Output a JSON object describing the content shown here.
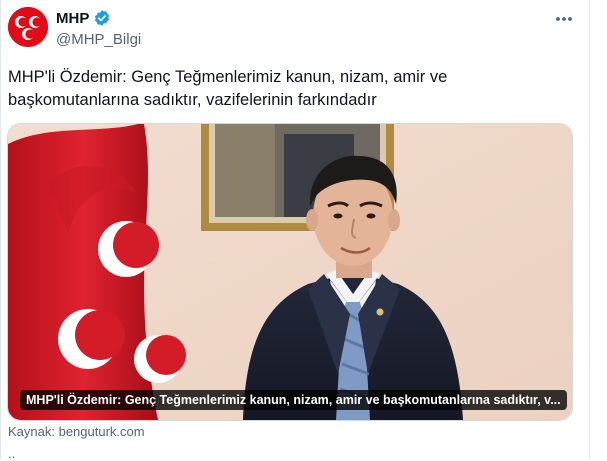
{
  "account": {
    "name": "MHP",
    "handle": "@MHP_Bilgi",
    "avatar_color": "#e30a17",
    "verified": true,
    "verified_color": "#1d9bf0"
  },
  "more_icon": "more-horizontal-icon",
  "tweet": {
    "text": "MHP'li Özdemir: Genç Teğmenlerimiz kanun, nizam, amir ve başkomutanlarına sadıktır, vazifelerinin farkındadır"
  },
  "card": {
    "overlay_title": "MHP'li Özdemir: Genç Teğmenlerimiz kanun, nizam, amir ve başkomutanlarına sadıktır, v..."
  },
  "source": "Kaynak: benguturk.com",
  "trailing_text": ".."
}
